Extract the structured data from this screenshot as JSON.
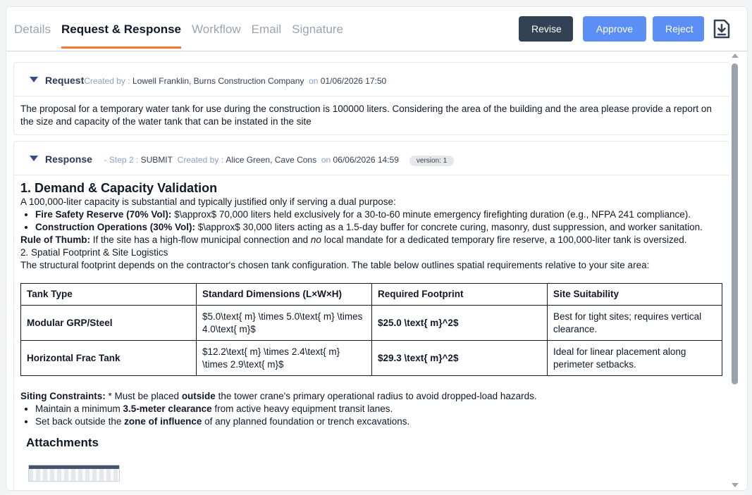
{
  "tabs": [
    {
      "label": "Details",
      "active": false
    },
    {
      "label": "Request & Response",
      "active": true
    },
    {
      "label": "Workflow",
      "active": false
    },
    {
      "label": "Email",
      "active": false
    },
    {
      "label": "Signature",
      "active": false
    }
  ],
  "actions": {
    "revise": "Revise",
    "approve": "Approve",
    "reject": "Reject"
  },
  "icons": {
    "download": "download-icon"
  },
  "colors": {
    "accent": "#f4792b",
    "primary_button": "#5b8ff6",
    "dark_button": "#334155"
  },
  "request": {
    "title": "Request",
    "created_by_label": "Created by :",
    "created_by": "Lowell Franklin, Burns Construction Company",
    "on_label": "on",
    "datetime": "01/06/2026 17:50",
    "body": "The proposal for a temporary water tank for use during the construction is 100000 liters. Considering the area of the building and the area please provide a report on the size and capacity of the water tank that can be instated in the site"
  },
  "response": {
    "title": "Response",
    "step": "- Step 2 :",
    "step_value": "SUBMIT",
    "created_by_label": "Created by :",
    "created_by": "Alice Green, Cave Cons",
    "on_label": "on",
    "datetime": "06/06/2026 14:59",
    "version": "version: 1",
    "heading": "1. Demand & Capacity Validation",
    "intro": "A 100,000-liter capacity is substantial and typically justified only if serving a dual purpose:",
    "bullets": [
      {
        "bold": "Fire Safety Reserve (70% Vol):",
        "text": " $\\approx$ 70,000 liters held exclusively for a 30-to-60 minute emergency firefighting duration (e.g., NFPA 241 compliance)."
      },
      {
        "bold": "Construction Operations (30% Vol):",
        "text": " $\\approx$ 30,000 liters acting as a 1.5-day buffer for concrete curing, masonry, dust suppression, and worker sanitation."
      }
    ],
    "rule_bold": "Rule of Thumb:",
    "rule_text_1": " If the site has a high-flow municipal connection and ",
    "rule_italic": "no",
    "rule_text_2": " local mandate for a dedicated temporary fire reserve, a 100,000-liter tank is oversized.",
    "section2": "2. Spatial Footprint & Site Logistics",
    "section2_text": "The structural footprint depends on the contractor's chosen tank configuration. The table below outlines spatial requirements relative to your site area:",
    "table": {
      "headers": [
        "Tank Type",
        "Standard Dimensions (L×W×H)",
        "Required Footprint",
        "Site Suitability"
      ],
      "rows": [
        [
          "Modular GRP/Steel",
          "$5.0\\text{ m} \\times 5.0\\text{ m} \\times 4.0\\text{ m}$",
          "$25.0 \\text{ m}^2$",
          "Best for tight sites; requires vertical clearance."
        ],
        [
          "Horizontal Frac Tank",
          "$12.2\\text{ m} \\times 2.4\\text{ m} \\times 2.9\\text{ m}$",
          "$29.3 \\text{ m}^2$",
          "Ideal for linear placement along perimeter setbacks."
        ]
      ]
    },
    "siting_bold": "Siting Constraints:",
    "siting_text_1": " * Must be placed ",
    "siting_bold2": "outside",
    "siting_text_2": " the tower crane's primary operational radius to avoid dropped-load hazards.",
    "siting_bullets": [
      {
        "pre": "Maintain a minimum ",
        "bold": "3.5-meter clearance",
        "post": " from active heavy equipment transit lanes."
      },
      {
        "pre": "Set back outside the ",
        "bold": "zone of influence",
        "post": " of any planned foundation or trench excavations."
      }
    ],
    "attachments_title": "Attachments"
  }
}
